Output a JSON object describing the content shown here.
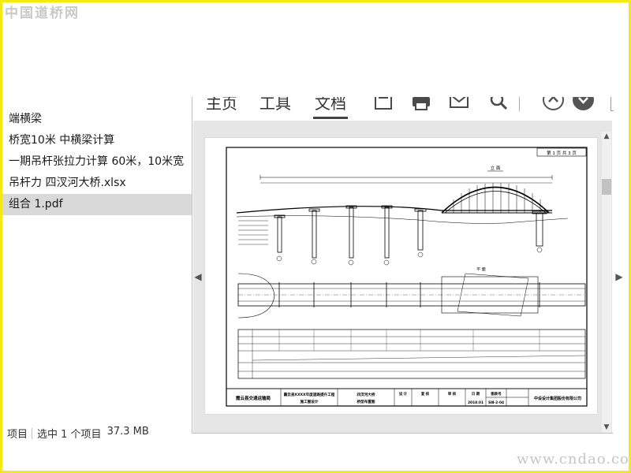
{
  "watermarks": {
    "top": "中国道桥网",
    "bottom": "www.cndao.com"
  },
  "file_list": [
    {
      "name": "端横梁",
      "selected": false
    },
    {
      "name": "桥宽10米  中横梁计算",
      "selected": false
    },
    {
      "name": "一期吊杆张拉力计算  60米，10米宽",
      "selected": false
    },
    {
      "name": "吊杆力 四汊河大桥.xlsx",
      "selected": false
    },
    {
      "name": "组合 1.pdf",
      "selected": true
    }
  ],
  "status_bar": {
    "count": "项目",
    "selection": "选中 1 个项目",
    "size": "37.3 MB"
  },
  "ribbon": {
    "tabs": [
      {
        "label": "主页",
        "active": false
      },
      {
        "label": "工具",
        "active": false
      },
      {
        "label": "文档",
        "active": true
      }
    ],
    "icons": [
      "save-icon",
      "print-icon",
      "mail-icon",
      "search-icon",
      "page-up-icon",
      "page-down-icon"
    ]
  },
  "drawing": {
    "page_info": "第 1 页   共 3 页",
    "title_elevation": "立 面",
    "title_plan": "平 面",
    "titleblock": {
      "client": "霞云县交通运输局",
      "project_line1": "霞云县XXXX年度道路提升工程",
      "project_line2": "施工图设计",
      "drawing_name_line1": "四汊河大桥",
      "drawing_name_line2": "桥型布置图",
      "design_label": "设 计",
      "review_label": "复 核",
      "check_label": "审 核",
      "date_label": "日 期",
      "date_value": "2018.01",
      "drawing_no_label": "图表号",
      "drawing_no_value": "SⅢ-2-04",
      "designer": "中设设计集团股份有限公司"
    }
  },
  "colors": {
    "selected_row": "#d9d9d9",
    "frame": "#f2ea12",
    "viewer_bg": "#e6e6e6"
  }
}
